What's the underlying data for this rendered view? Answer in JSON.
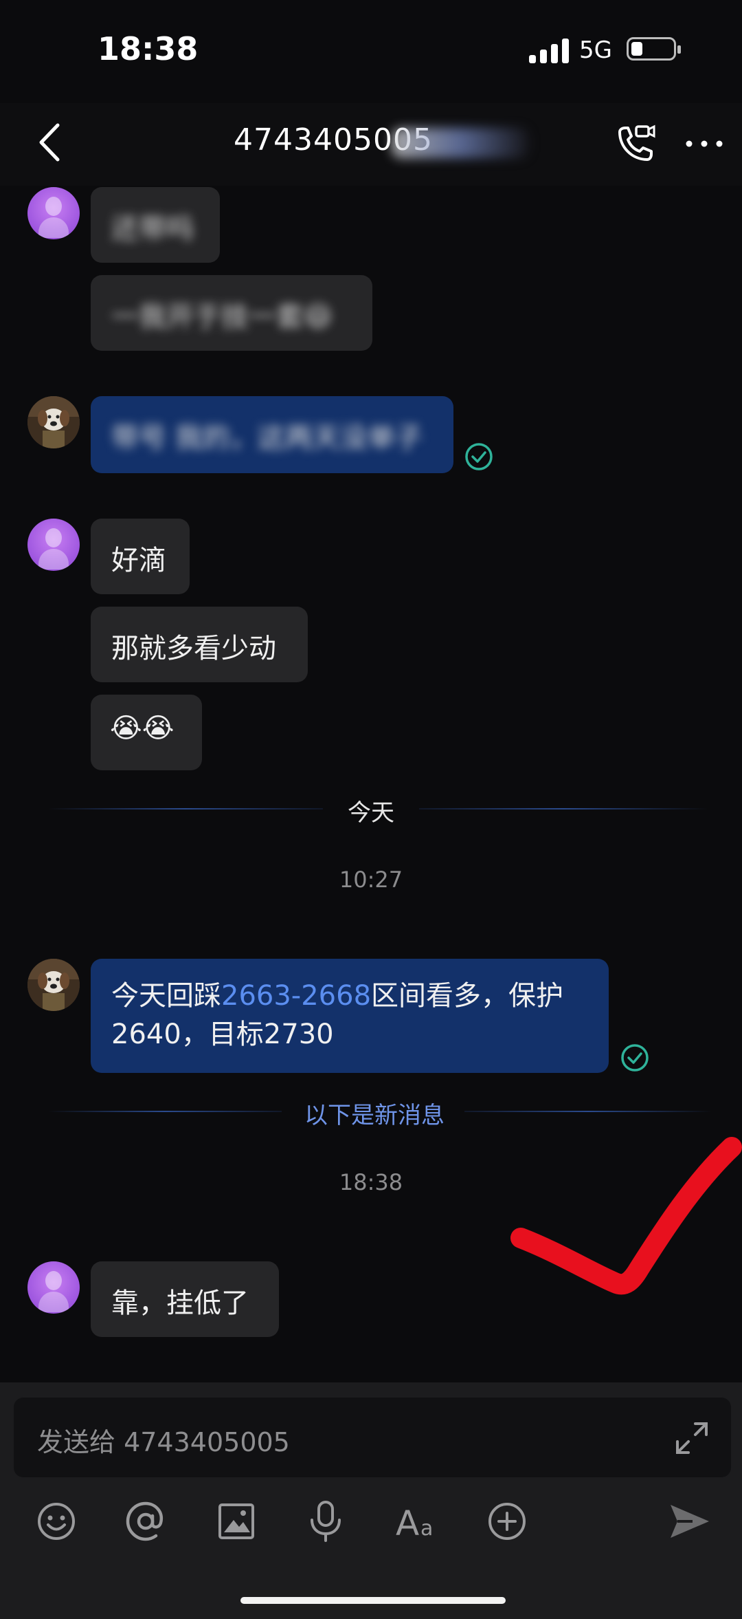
{
  "status": {
    "time": "18:38",
    "network": "5G"
  },
  "header": {
    "title": "4743405005"
  },
  "messages": {
    "m1_text": "还带吗",
    "m2_text": "一我开于技一套😄",
    "m3_text": "带号 我的，这两天没单子",
    "m4_text": "好滴",
    "m5_text": "那就多看少动",
    "m6_text": "😭😭",
    "m7_pre": "今天回踩",
    "m7_range": "2663-2668",
    "m7_post": "区间看多，保护",
    "m7_line2": "2640，目标2730",
    "m8_text": "靠，挂低了"
  },
  "dividers": {
    "today": "今天",
    "new_messages": "以下是新消息"
  },
  "timestamps": {
    "t1": "10:27",
    "t2": "18:38"
  },
  "input": {
    "placeholder": "发送给 4743405005"
  },
  "colors": {
    "background": "#0b0b0d",
    "gray_bubble": "#262628",
    "blue_bubble": "#13316a",
    "link_blue": "#5b8ef0",
    "check_green": "#2fb39a",
    "annotation_red": "#e8101e"
  },
  "icons": {
    "toolbar": [
      "emoji-icon",
      "mention-icon",
      "image-icon",
      "microphone-icon",
      "text-format-icon",
      "plus-icon",
      "send-icon"
    ]
  }
}
